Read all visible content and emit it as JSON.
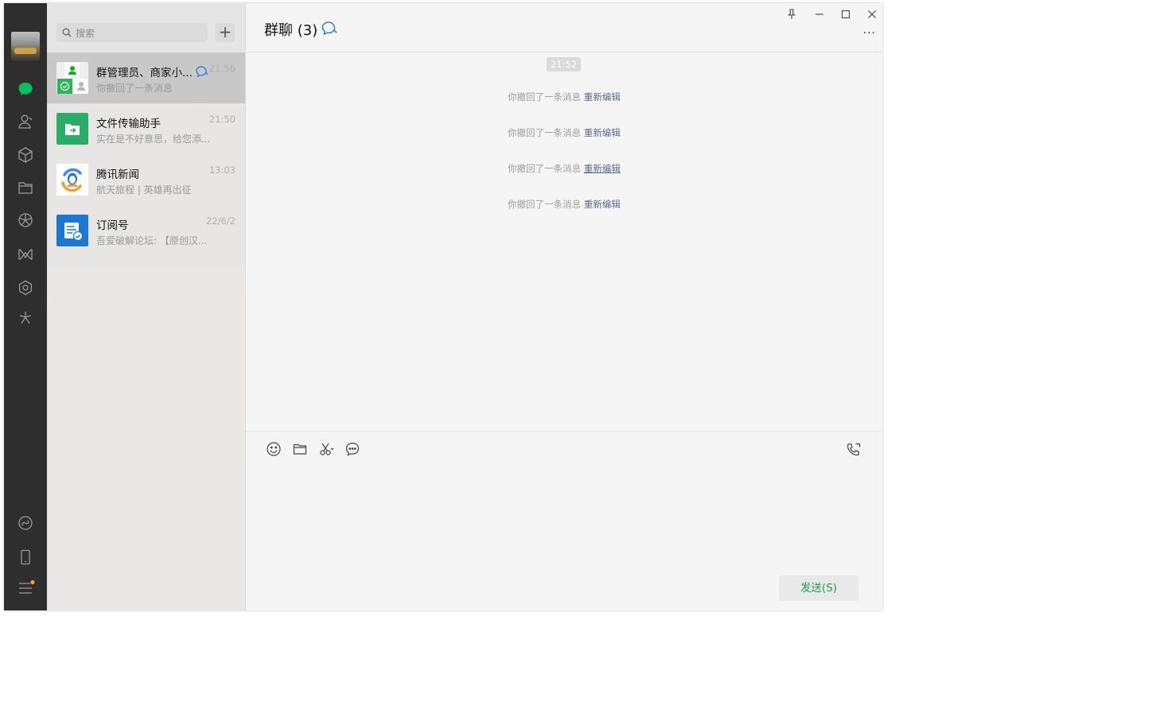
{
  "search": {
    "placeholder": "搜索"
  },
  "add_label": "+",
  "chats": [
    {
      "name": "群管理员、商家小...",
      "time": "21:56",
      "preview": "你撤回了一条消息",
      "active": true
    },
    {
      "name": "文件传输助手",
      "time": "21:50",
      "preview": "实在是不好意思，给您添..."
    },
    {
      "name": "腾讯新闻",
      "time": "13:03",
      "preview": "航天旅程 | 英雄再出征"
    },
    {
      "name": "订阅号",
      "time": "22/6/2",
      "preview": "吾爱破解论坛: 【原创汉..."
    }
  ],
  "chat": {
    "title": "群聊 (3)",
    "timestamp": "21:52",
    "system_messages": [
      {
        "text": "你撤回了一条消息",
        "link": "重新编辑"
      },
      {
        "text": "你撤回了一条消息",
        "link": "重新编辑"
      },
      {
        "text": "你撤回了一条消息",
        "link": "重新编辑"
      },
      {
        "text": "你撤回了一条消息",
        "link": "重新编辑"
      }
    ],
    "more_label": "···",
    "send_label": "发送(S)"
  },
  "colors": {
    "accent": "#07c160",
    "nav_bg": "#2e2e2e",
    "link": "#586c8c",
    "send_text": "#1f9d55"
  }
}
